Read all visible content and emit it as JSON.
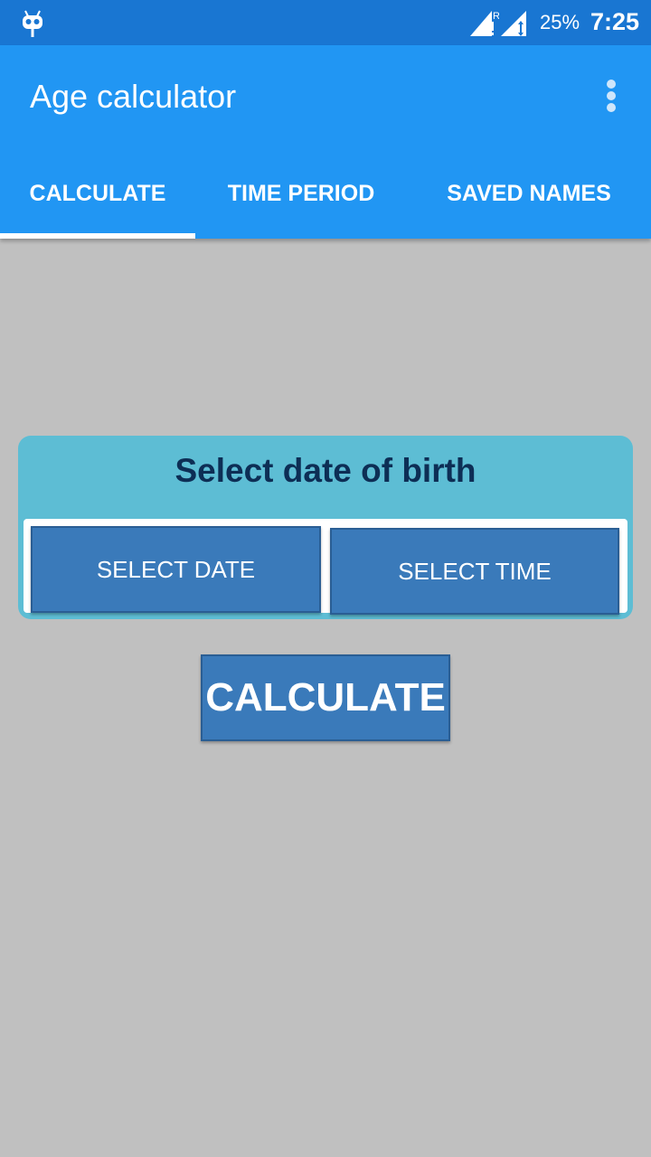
{
  "status_bar": {
    "app_icon": "cyanogen-bot-icon",
    "signal_icons": [
      "signal-roaming-icon",
      "signal-data-icon"
    ],
    "battery": "25%",
    "time": "7:25"
  },
  "app_bar": {
    "title": "Age calculator",
    "overflow_icon": "more-vert-icon"
  },
  "tabs": [
    {
      "label": "CALCULATE",
      "selected": true
    },
    {
      "label": "TIME PERIOD",
      "selected": false
    },
    {
      "label": "SAVED NAMES",
      "selected": false
    }
  ],
  "card": {
    "title": "Select date of birth",
    "select_date_label": "SELECT DATE",
    "select_time_label": "SELECT TIME"
  },
  "calculate_button_label": "CALCULATE",
  "colors": {
    "status_bar": "#1976d2",
    "app_bar": "#2196f3",
    "card": "#5dbdd4",
    "button": "#3a7aba",
    "card_title": "#0d2e55",
    "background": "#c0c0c0"
  }
}
